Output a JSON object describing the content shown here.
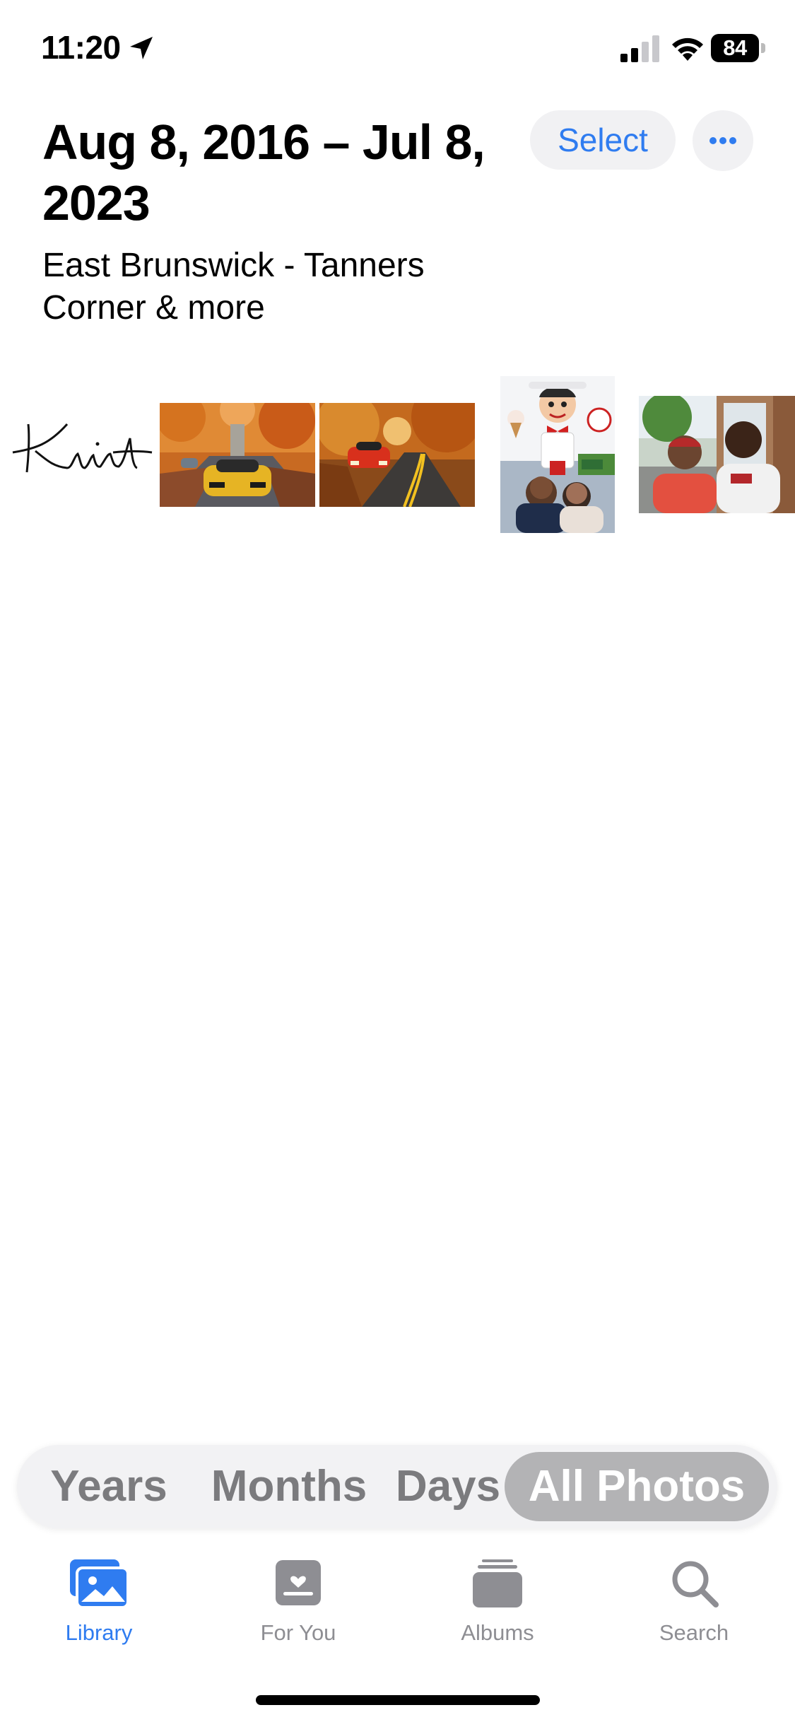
{
  "status_bar": {
    "time": "11:20",
    "battery": "84",
    "location_icon": "location-arrow-icon",
    "signal_icon": "cellular-signal-icon",
    "wifi_icon": "wifi-icon"
  },
  "header": {
    "title": "Aug 8, 2016 – Jul 8, 2023",
    "subtitle": "East Brunswick - Tanners Corner & more",
    "select_label": "Select",
    "more_icon": "ellipsis-icon"
  },
  "photos": [
    {
      "subject": "handwritten signature",
      "signature_text": "Khint"
    },
    {
      "subject": "yellow sports car on autumn street"
    },
    {
      "subject": "red sports car on autumn road"
    },
    {
      "subject": "two people in front of a roadside mascot statue"
    },
    {
      "subject": "two men taking a selfie outdoors"
    }
  ],
  "view_modes": {
    "items": [
      "Years",
      "Months",
      "Days",
      "All Photos"
    ],
    "selected": "All Photos"
  },
  "tabs": [
    {
      "label": "Library",
      "icon": "photo-library-icon",
      "active": true
    },
    {
      "label": "For You",
      "icon": "for-you-icon",
      "active": false
    },
    {
      "label": "Albums",
      "icon": "albums-icon",
      "active": false
    },
    {
      "label": "Search",
      "icon": "search-icon",
      "active": false
    }
  ],
  "colors": {
    "accent": "#2f7cf0",
    "inactive": "#8e8e93",
    "segment_bg": "#f2f2f4",
    "segment_active": "#b3b3b5"
  }
}
